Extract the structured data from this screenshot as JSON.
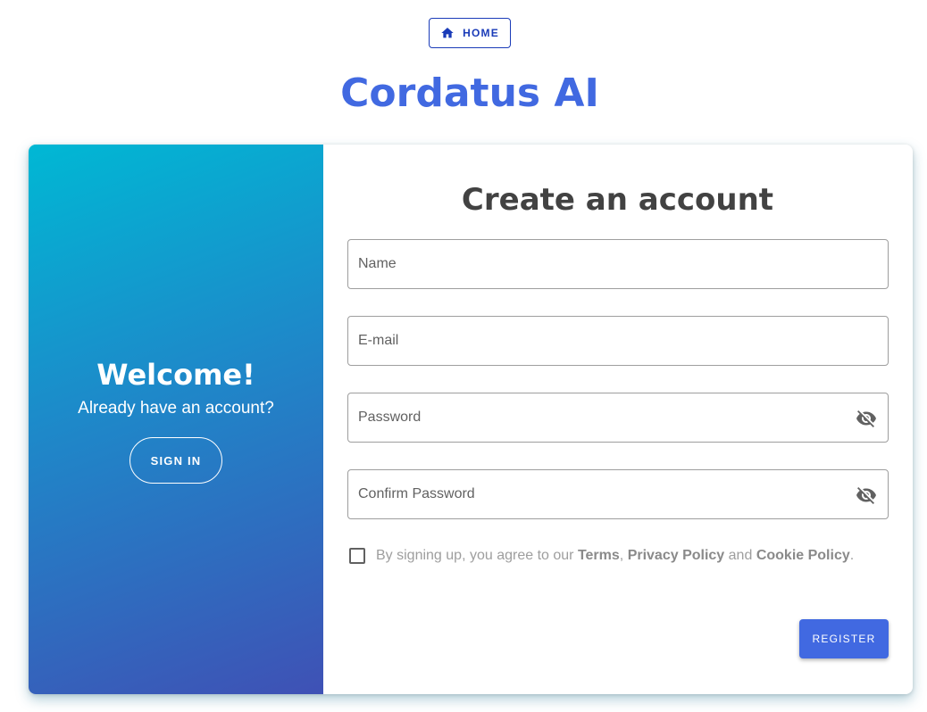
{
  "header": {
    "home_label": "HOME",
    "home_icon": "home-icon",
    "app_title": "Cordatus AI"
  },
  "left_panel": {
    "welcome": "Welcome!",
    "subtitle": "Already have an account?",
    "sign_in_label": "SIGN IN"
  },
  "form": {
    "title": "Create an account",
    "fields": [
      {
        "placeholder": "Name",
        "value": ""
      },
      {
        "placeholder": "E-mail",
        "value": ""
      },
      {
        "placeholder": "Password",
        "value": "",
        "icon": "visibility-off-icon"
      },
      {
        "placeholder": "Confirm Password",
        "value": "",
        "icon": "visibility-off-icon"
      }
    ],
    "terms": {
      "checked": false,
      "prefix": "By signing up, you agree to our",
      "terms_link": "Terms",
      "comma": ",",
      "privacy_link": "Privacy Policy",
      "and": "and",
      "cookie_link": "Cookie Policy",
      "period": "."
    },
    "register_label": "REGISTER"
  },
  "colors": {
    "brand": "#4169e1",
    "home_border": "#1a3bb8",
    "gradient_start": "#00b8d4",
    "gradient_end": "#3f51b5"
  }
}
